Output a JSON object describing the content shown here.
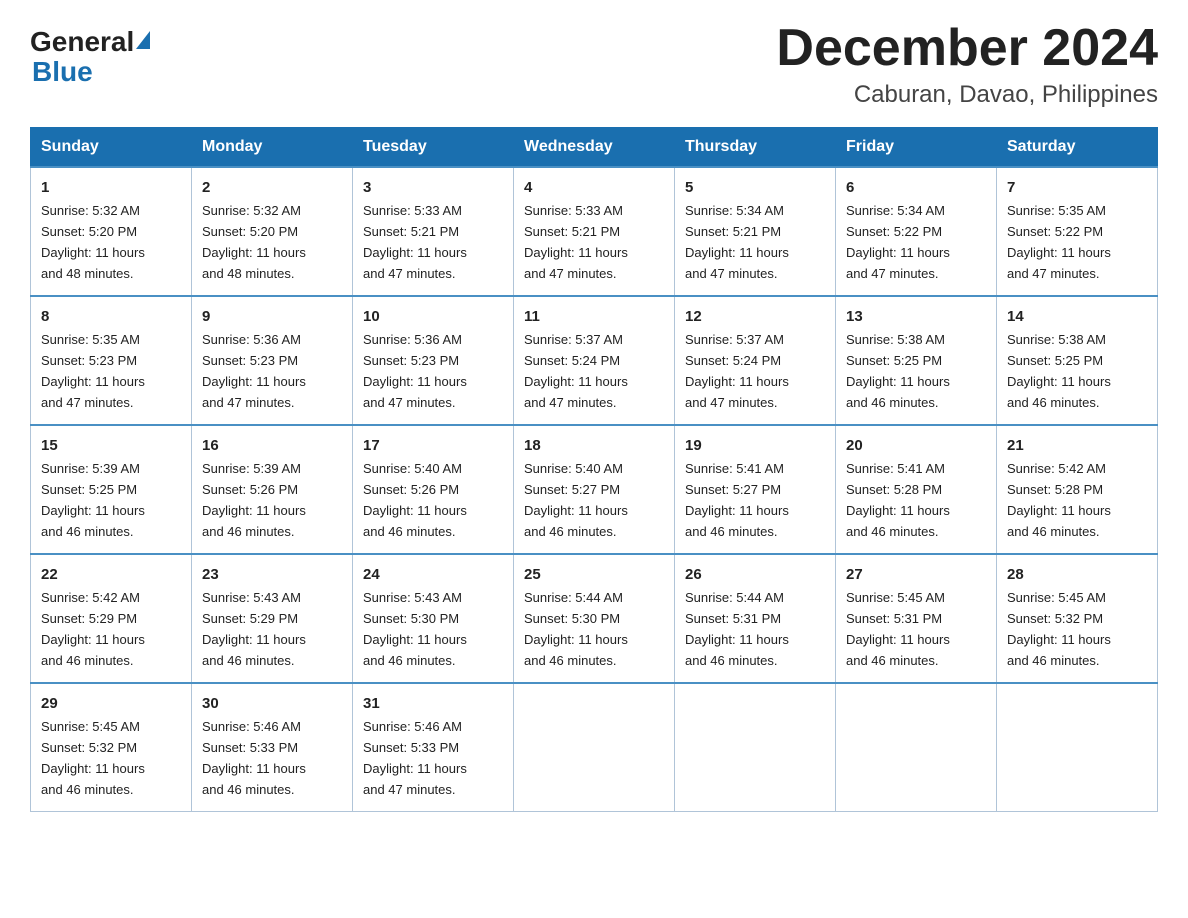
{
  "logo": {
    "general": "General",
    "blue": "Blue"
  },
  "title": "December 2024",
  "subtitle": "Caburan, Davao, Philippines",
  "headers": [
    "Sunday",
    "Monday",
    "Tuesday",
    "Wednesday",
    "Thursday",
    "Friday",
    "Saturday"
  ],
  "weeks": [
    [
      {
        "day": "1",
        "sunrise": "5:32 AM",
        "sunset": "5:20 PM",
        "daylight": "11 hours and 48 minutes."
      },
      {
        "day": "2",
        "sunrise": "5:32 AM",
        "sunset": "5:20 PM",
        "daylight": "11 hours and 48 minutes."
      },
      {
        "day": "3",
        "sunrise": "5:33 AM",
        "sunset": "5:21 PM",
        "daylight": "11 hours and 47 minutes."
      },
      {
        "day": "4",
        "sunrise": "5:33 AM",
        "sunset": "5:21 PM",
        "daylight": "11 hours and 47 minutes."
      },
      {
        "day": "5",
        "sunrise": "5:34 AM",
        "sunset": "5:21 PM",
        "daylight": "11 hours and 47 minutes."
      },
      {
        "day": "6",
        "sunrise": "5:34 AM",
        "sunset": "5:22 PM",
        "daylight": "11 hours and 47 minutes."
      },
      {
        "day": "7",
        "sunrise": "5:35 AM",
        "sunset": "5:22 PM",
        "daylight": "11 hours and 47 minutes."
      }
    ],
    [
      {
        "day": "8",
        "sunrise": "5:35 AM",
        "sunset": "5:23 PM",
        "daylight": "11 hours and 47 minutes."
      },
      {
        "day": "9",
        "sunrise": "5:36 AM",
        "sunset": "5:23 PM",
        "daylight": "11 hours and 47 minutes."
      },
      {
        "day": "10",
        "sunrise": "5:36 AM",
        "sunset": "5:23 PM",
        "daylight": "11 hours and 47 minutes."
      },
      {
        "day": "11",
        "sunrise": "5:37 AM",
        "sunset": "5:24 PM",
        "daylight": "11 hours and 47 minutes."
      },
      {
        "day": "12",
        "sunrise": "5:37 AM",
        "sunset": "5:24 PM",
        "daylight": "11 hours and 47 minutes."
      },
      {
        "day": "13",
        "sunrise": "5:38 AM",
        "sunset": "5:25 PM",
        "daylight": "11 hours and 46 minutes."
      },
      {
        "day": "14",
        "sunrise": "5:38 AM",
        "sunset": "5:25 PM",
        "daylight": "11 hours and 46 minutes."
      }
    ],
    [
      {
        "day": "15",
        "sunrise": "5:39 AM",
        "sunset": "5:25 PM",
        "daylight": "11 hours and 46 minutes."
      },
      {
        "day": "16",
        "sunrise": "5:39 AM",
        "sunset": "5:26 PM",
        "daylight": "11 hours and 46 minutes."
      },
      {
        "day": "17",
        "sunrise": "5:40 AM",
        "sunset": "5:26 PM",
        "daylight": "11 hours and 46 minutes."
      },
      {
        "day": "18",
        "sunrise": "5:40 AM",
        "sunset": "5:27 PM",
        "daylight": "11 hours and 46 minutes."
      },
      {
        "day": "19",
        "sunrise": "5:41 AM",
        "sunset": "5:27 PM",
        "daylight": "11 hours and 46 minutes."
      },
      {
        "day": "20",
        "sunrise": "5:41 AM",
        "sunset": "5:28 PM",
        "daylight": "11 hours and 46 minutes."
      },
      {
        "day": "21",
        "sunrise": "5:42 AM",
        "sunset": "5:28 PM",
        "daylight": "11 hours and 46 minutes."
      }
    ],
    [
      {
        "day": "22",
        "sunrise": "5:42 AM",
        "sunset": "5:29 PM",
        "daylight": "11 hours and 46 minutes."
      },
      {
        "day": "23",
        "sunrise": "5:43 AM",
        "sunset": "5:29 PM",
        "daylight": "11 hours and 46 minutes."
      },
      {
        "day": "24",
        "sunrise": "5:43 AM",
        "sunset": "5:30 PM",
        "daylight": "11 hours and 46 minutes."
      },
      {
        "day": "25",
        "sunrise": "5:44 AM",
        "sunset": "5:30 PM",
        "daylight": "11 hours and 46 minutes."
      },
      {
        "day": "26",
        "sunrise": "5:44 AM",
        "sunset": "5:31 PM",
        "daylight": "11 hours and 46 minutes."
      },
      {
        "day": "27",
        "sunrise": "5:45 AM",
        "sunset": "5:31 PM",
        "daylight": "11 hours and 46 minutes."
      },
      {
        "day": "28",
        "sunrise": "5:45 AM",
        "sunset": "5:32 PM",
        "daylight": "11 hours and 46 minutes."
      }
    ],
    [
      {
        "day": "29",
        "sunrise": "5:45 AM",
        "sunset": "5:32 PM",
        "daylight": "11 hours and 46 minutes."
      },
      {
        "day": "30",
        "sunrise": "5:46 AM",
        "sunset": "5:33 PM",
        "daylight": "11 hours and 46 minutes."
      },
      {
        "day": "31",
        "sunrise": "5:46 AM",
        "sunset": "5:33 PM",
        "daylight": "11 hours and 47 minutes."
      },
      null,
      null,
      null,
      null
    ]
  ],
  "labels": {
    "sunrise": "Sunrise:",
    "sunset": "Sunset:",
    "daylight": "Daylight:"
  }
}
